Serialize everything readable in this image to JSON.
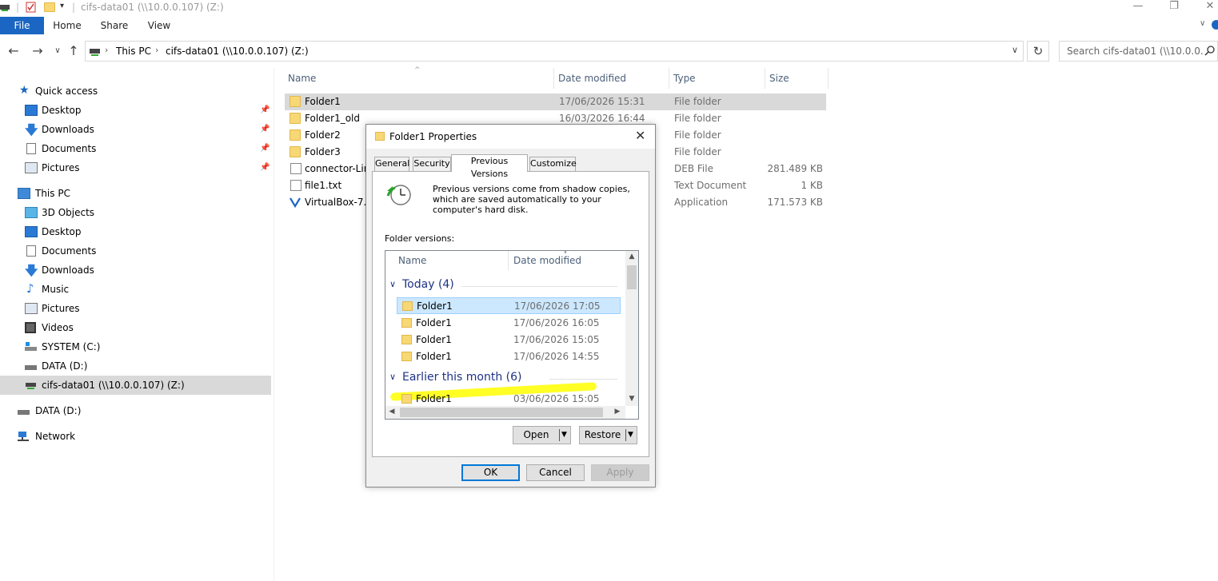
{
  "window": {
    "title": "cifs-data01 (\\\\10.0.0.107) (Z:)"
  },
  "ribbon": {
    "tabs": [
      "File",
      "Home",
      "Share",
      "View"
    ]
  },
  "address": {
    "crumbs": [
      "This PC",
      "cifs-data01 (\\\\10.0.0.107) (Z:)"
    ],
    "search_placeholder": "Search cifs-data01 (\\\\10.0.0.10..."
  },
  "nav": {
    "quick_access": "Quick access",
    "quick_items": [
      "Desktop",
      "Downloads",
      "Documents",
      "Pictures"
    ],
    "this_pc": "This PC",
    "pc_items": [
      "3D Objects",
      "Desktop",
      "Documents",
      "Downloads",
      "Music",
      "Pictures",
      "Videos",
      "SYSTEM (C:)",
      "DATA (D:)",
      "cifs-data01 (\\\\10.0.0.107) (Z:)"
    ],
    "data_d": "DATA (D:)",
    "network": "Network"
  },
  "files": {
    "columns": [
      "Name",
      "Date modified",
      "Type",
      "Size"
    ],
    "rows": [
      {
        "name": "Folder1",
        "date": "17/06/2026 15:31",
        "type": "File folder",
        "size": ""
      },
      {
        "name": "Folder1_old",
        "date": "16/03/2026 16:44",
        "type": "File folder",
        "size": ""
      },
      {
        "name": "Folder2",
        "date": "",
        "type": "File folder",
        "size": ""
      },
      {
        "name": "Folder3",
        "date": "",
        "type": "File folder",
        "size": ""
      },
      {
        "name": "connector-Lin",
        "date": "",
        "type": "DEB File",
        "size": "281.489 KB"
      },
      {
        "name": "file1.txt",
        "date": "",
        "type": "Text Document",
        "size": "1 KB"
      },
      {
        "name": "VirtualBox-7.2.",
        "date": "",
        "type": "Application",
        "size": "171.573 KB"
      }
    ]
  },
  "dialog": {
    "title": "Folder1 Properties",
    "tabs": [
      "General",
      "Security",
      "Previous Versions",
      "Customize"
    ],
    "description": "Previous versions come from shadow copies, which are saved automatically to your computer's hard disk.",
    "folder_versions_label": "Folder versions:",
    "list_columns": [
      "Name",
      "Date modified"
    ],
    "groups": [
      {
        "label": "Today (4)",
        "items": [
          {
            "name": "Folder1",
            "date": "17/06/2026 17:05"
          },
          {
            "name": "Folder1",
            "date": "17/06/2026 16:05"
          },
          {
            "name": "Folder1",
            "date": "17/06/2026 15:05"
          },
          {
            "name": "Folder1",
            "date": "17/06/2026 14:55"
          }
        ]
      },
      {
        "label": "Earlier this month (6)",
        "items": [
          {
            "name": "Folder1",
            "date": "03/06/2026 15:05"
          }
        ]
      }
    ],
    "open_label": "Open",
    "restore_label": "Restore",
    "ok_label": "OK",
    "cancel_label": "Cancel",
    "apply_label": "Apply"
  },
  "colors": {
    "file_tab": "#1a66c2",
    "selection": "#d9d9d9",
    "version_selected": "#cce8ff",
    "group_header": "#1e3287",
    "highlight": "#ffff00"
  }
}
